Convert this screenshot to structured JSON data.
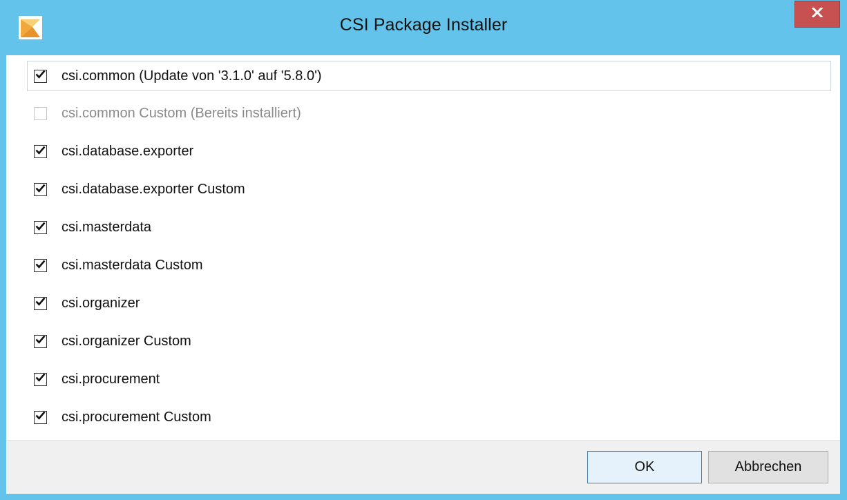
{
  "window": {
    "title": "CSI Package Installer",
    "icon": "app-logo-icon",
    "close_glyph": "x"
  },
  "packages": [
    {
      "label": "csi.common (Update von '3.1.0' auf '5.8.0')",
      "checked": true,
      "disabled": false
    },
    {
      "label": "csi.common Custom (Bereits installiert)",
      "checked": false,
      "disabled": true
    },
    {
      "label": "csi.database.exporter",
      "checked": true,
      "disabled": false
    },
    {
      "label": "csi.database.exporter Custom",
      "checked": true,
      "disabled": false
    },
    {
      "label": "csi.masterdata",
      "checked": true,
      "disabled": false
    },
    {
      "label": "csi.masterdata Custom",
      "checked": true,
      "disabled": false
    },
    {
      "label": "csi.organizer",
      "checked": true,
      "disabled": false
    },
    {
      "label": "csi.organizer Custom",
      "checked": true,
      "disabled": false
    },
    {
      "label": "csi.procurement",
      "checked": true,
      "disabled": false
    },
    {
      "label": "csi.procurement Custom",
      "checked": true,
      "disabled": false
    }
  ],
  "buttons": {
    "ok_label": "OK",
    "cancel_label": "Abbrechen"
  },
  "colors": {
    "titlebar": "#64c3ea",
    "close_button": "#c75050",
    "footer": "#f0f0f0",
    "ok_border": "#3c7fb1"
  }
}
